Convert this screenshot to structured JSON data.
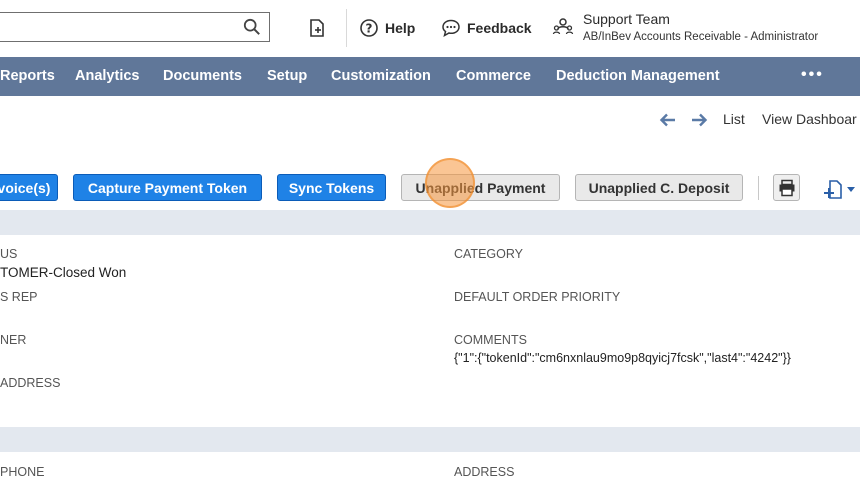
{
  "header": {
    "search": {
      "placeholder": ""
    },
    "help": "Help",
    "feedback": "Feedback",
    "user": {
      "name": "Support Team",
      "role": "AB/InBev Accounts Receivable - Administrator"
    }
  },
  "nav": {
    "items": [
      "Reports",
      "Analytics",
      "Documents",
      "Setup",
      "Customization",
      "Commerce",
      "Deduction Management"
    ],
    "more": "•••"
  },
  "page_nav": {
    "list": "List",
    "view_dashboard": "View Dashboar"
  },
  "buttons": {
    "invoices": "voice(s)",
    "capture_token": "Capture Payment Token",
    "sync_tokens": "Sync Tokens",
    "unapplied_payment": "Unapplied Payment",
    "unapplied_deposit": "Unapplied C. Deposit"
  },
  "fields": {
    "status": {
      "label": "US",
      "value": "TOMER-Closed Won"
    },
    "category": {
      "label": "CATEGORY",
      "value": ""
    },
    "sales_rep": {
      "label": "S REP",
      "value": ""
    },
    "default_order_priority": {
      "label": "DEFAULT ORDER PRIORITY",
      "value": ""
    },
    "partner": {
      "label": "NER",
      "value": ""
    },
    "comments": {
      "label": "COMMENTS",
      "value": "{\"1\":{\"tokenId\":\"cm6nxnlau9mo9p8qyicj7fcsk\",\"last4\":\"4242\"}}"
    },
    "address_left": {
      "label": "ADDRESS",
      "value": ""
    },
    "phone": {
      "label": "PHONE",
      "value": ""
    },
    "address": {
      "label": "ADDRESS",
      "value": ""
    }
  },
  "colors": {
    "nav_bg": "#607799",
    "primary_button": "#1f82e6",
    "section_band": "#e3e8ef",
    "click_highlight": "#f5963c"
  }
}
